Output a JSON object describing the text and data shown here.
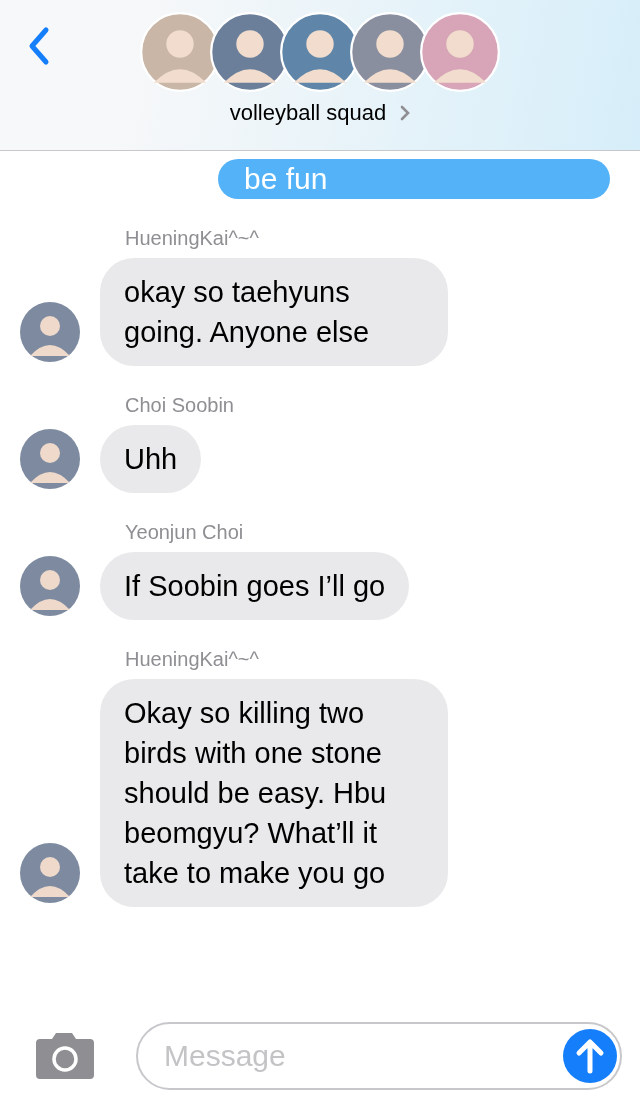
{
  "header": {
    "title": "volleyball squad"
  },
  "messages": [
    {
      "kind": "sent",
      "text": "be fun"
    },
    {
      "kind": "received",
      "sender": "HueningKai^~^",
      "text": "okay so taehyuns going. Anyone else"
    },
    {
      "kind": "received",
      "sender": "Choi Soobin",
      "text": "Uhh"
    },
    {
      "kind": "received",
      "sender": "Yeonjun Choi",
      "text": "If Soobin goes I’ll go"
    },
    {
      "kind": "received",
      "sender": "HueningKai^~^",
      "text": "Okay so killing two birds with one stone should be easy. Hbu beomgyu? What’ll it take to make you go"
    }
  ],
  "composer": {
    "placeholder": "Message"
  }
}
